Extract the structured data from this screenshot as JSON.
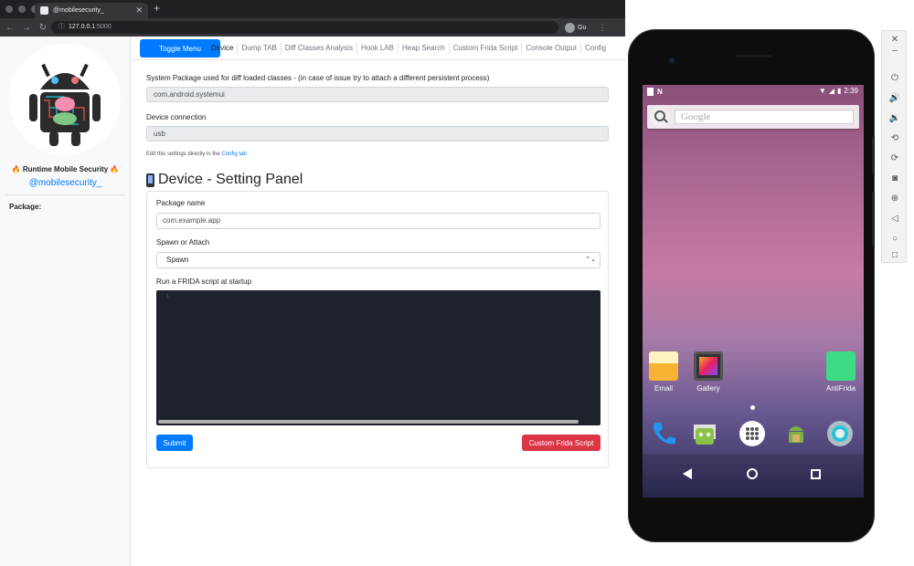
{
  "browser": {
    "tab_title": "@mobilesecurity_",
    "url_host": "127.0.0.1",
    "url_port": ":5000",
    "profile_label": "Gu"
  },
  "sidebar": {
    "app_name": "🔥 Runtime Mobile Security 🔥",
    "handle": "@mobilesecurity_",
    "package_label": "Package:"
  },
  "nav": {
    "toggle_label": "Toggle Menu",
    "tabs": [
      {
        "label": "Device",
        "active": true
      },
      {
        "label": "Dump TAB"
      },
      {
        "label": "Diff Classes Analysis"
      },
      {
        "label": "Hook LAB"
      },
      {
        "label": "Heap Search"
      },
      {
        "label": "Custom Frida Script"
      },
      {
        "label": "Console Output"
      },
      {
        "label": "Config"
      }
    ]
  },
  "config": {
    "system_package_label": "System Package used for diff loaded classes - (in case of issue try to attach a different persistent process)",
    "system_package_value": "com.android.systemui",
    "device_connection_label": "Device connection",
    "device_connection_value": "usb",
    "hint_prefix": "Edit this settings directly in the ",
    "hint_link": "Config tab"
  },
  "panel": {
    "title": "Device - Setting Panel",
    "package_name_label": "Package name",
    "package_name_value": "com.example.app",
    "spawn_label": "Spawn or Attach",
    "spawn_value": "Spawn",
    "script_label": "Run a FRIDA script at startup",
    "editor_line": "1",
    "submit_label": "Submit",
    "custom_script_label": "Custom Frida Script"
  },
  "android": {
    "time": "2:39",
    "search_placeholder": "Google",
    "apps": [
      {
        "label": "Email"
      },
      {
        "label": "Gallery"
      },
      {
        "label": "AntiFrida"
      }
    ]
  },
  "colors": {
    "primary": "#007bff",
    "danger": "#dc3545"
  }
}
